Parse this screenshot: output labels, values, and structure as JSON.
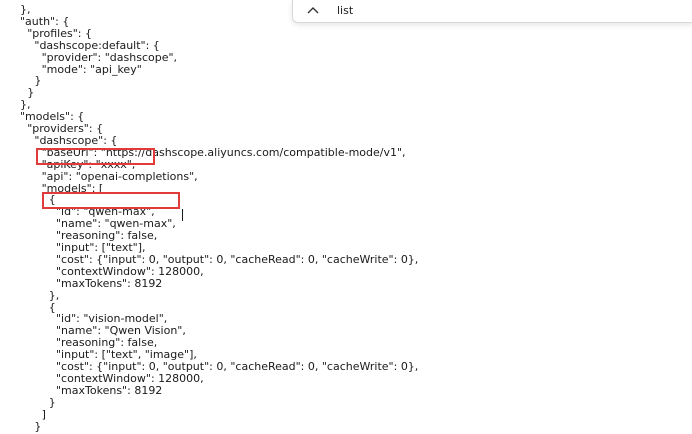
{
  "find_bar": {
    "toggle_icon": "chevron-up-icon",
    "query": "list"
  },
  "code": {
    "lines": [
      "},",
      "\"auth\": {",
      "  \"profiles\": {",
      "    \"dashscope:default\": {",
      "      \"provider\": \"dashscope\",",
      "      \"mode\": \"api_key\"",
      "    }",
      "  }",
      "},",
      "\"models\": {",
      "  \"providers\": {",
      "    \"dashscope\": {",
      "      \"baseUrl\": \"https://dashscope.aliyuncs.com/compatible-mode/v1\",",
      "      \"apiKey\": \"xxxx\",",
      "      \"api\": \"openai-completions\",",
      "      \"models\": [",
      "        {",
      "          \"id\": \"qwen-max\",",
      "          \"name\": \"qwen-max\",",
      "          \"reasoning\": false,",
      "          \"input\": [\"text\"],",
      "          \"cost\": {\"input\": 0, \"output\": 0, \"cacheRead\": 0, \"cacheWrite\": 0},",
      "          \"contextWindow\": 128000,",
      "          \"maxTokens\": 8192",
      "        },",
      "        {",
      "          \"id\": \"vision-model\",",
      "          \"name\": \"Qwen Vision\",",
      "          \"reasoning\": false,",
      "          \"input\": [\"text\", \"image\"],",
      "          \"cost\": {\"input\": 0, \"output\": 0, \"cacheRead\": 0, \"cacheWrite\": 0},",
      "          \"contextWindow\": 128000,",
      "          \"maxTokens\": 8192",
      "        }",
      "      ]",
      "    }"
    ]
  },
  "highlights": {
    "color": "#e03a3a",
    "marked_lines": [
      "\"apiKey\": \"xxxx\",",
      "\"id\": \"qwen-max\","
    ]
  },
  "colors": {
    "text": "#1a1a1a",
    "background": "#ffffff"
  }
}
